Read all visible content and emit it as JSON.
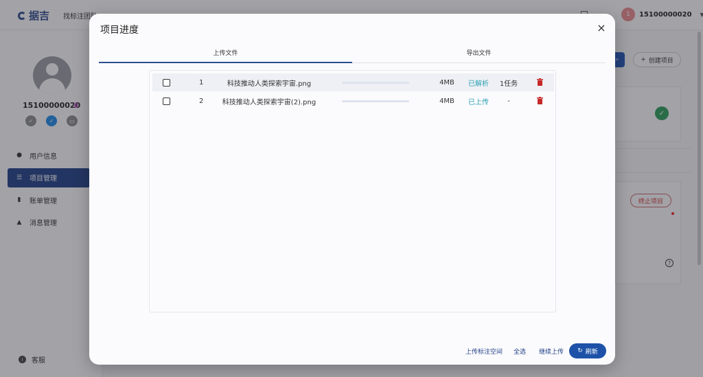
{
  "app": {
    "logo_text": "据吉",
    "top_nav_text": "找标注团队",
    "user_avatar_letter": "1",
    "username": "15100000020"
  },
  "sidebar": {
    "username": "15100000020",
    "menu": [
      {
        "label": "用户信息",
        "icon": "user-icon",
        "active": false
      },
      {
        "label": "项目管理",
        "icon": "list-icon",
        "active": true
      },
      {
        "label": "账单管理",
        "icon": "bill-icon",
        "active": false
      },
      {
        "label": "消息管理",
        "icon": "bell-icon",
        "active": false
      }
    ],
    "support_label": "客服"
  },
  "background": {
    "create_project_label": "创建项目",
    "stop_project_label": "终止项目"
  },
  "dialog": {
    "title": "项目进度",
    "tabs": [
      {
        "label": "上传文件",
        "active": true
      },
      {
        "label": "导出文件",
        "active": false
      }
    ],
    "files": [
      {
        "index": "1",
        "name": "科技推动人类探索宇宙.png",
        "progress": 1.0,
        "size": "4MB",
        "status": "已解析",
        "tasks": "1任务"
      },
      {
        "index": "2",
        "name": "科技推动人类探索宇宙(2).png",
        "progress": 1.0,
        "size": "4MB",
        "status": "已上传",
        "tasks": "-"
      }
    ],
    "footer": {
      "upload_space_label": "上传标注空间",
      "select_all_label": "全选",
      "continue_upload_label": "继续上传",
      "refresh_label": "刷新"
    }
  },
  "colors": {
    "primary": "#1f3f86",
    "status_parsed": "#2fa3b5",
    "delete": "#c62828"
  }
}
